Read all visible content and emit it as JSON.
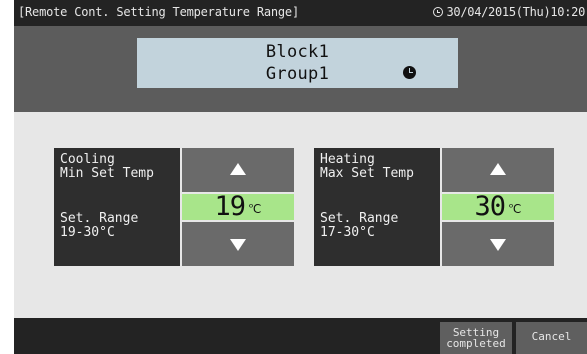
{
  "topbar": {
    "title": "[Remote Cont. Setting Temperature Range]",
    "datetime": "30/04/2015(Thu)10:20"
  },
  "header": {
    "block": "Block1",
    "group": "Group1"
  },
  "cooling": {
    "name": "Cooling\nMin Set Temp",
    "range": "Set. Range\n19-30°C",
    "value": "19",
    "unit": "℃"
  },
  "heating": {
    "name": "Heating\nMax Set Temp",
    "range": "Set. Range\n17-30°C",
    "value": "30",
    "unit": "℃"
  },
  "footer": {
    "setting_line1": "Setting",
    "setting_line2": "completed",
    "cancel": "Cancel"
  },
  "colors": {
    "value_highlight": "#a8e58a",
    "header_box": "#c2d3dc"
  }
}
